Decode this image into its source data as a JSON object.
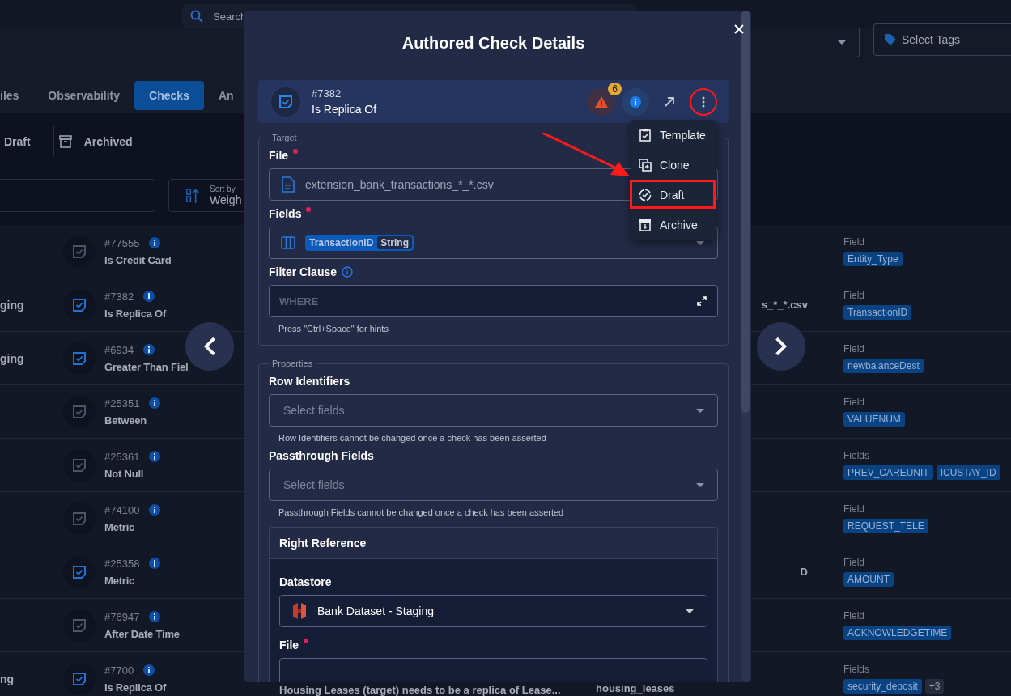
{
  "background": {
    "search": {
      "placeholder": "Search"
    },
    "tag_filter": {
      "placeholder": "Select Tags"
    },
    "tabs": [
      {
        "label": "iles",
        "selected": false
      },
      {
        "label": "Observability",
        "selected": false
      },
      {
        "label": "Checks",
        "selected": true
      },
      {
        "label": "An",
        "selected": false
      }
    ],
    "status_filters": [
      {
        "label": "Draft",
        "kind": "draft"
      },
      {
        "label": "Archived",
        "kind": "archived"
      }
    ],
    "sort": {
      "label": "Sort by",
      "value": "Weigh"
    },
    "rows": [
      {
        "id": "#77555",
        "name": "Is Credit Card",
        "color": "#4c5467",
        "field_label": "Field",
        "tags": [
          "Entity_Type"
        ]
      },
      {
        "edge": "ging",
        "id": "#7382",
        "name": "Is Replica Of",
        "color": "#1f73d6",
        "file_tail": "s_*_*.csv",
        "field_label": "Field",
        "tags": [
          "TransactionID"
        ]
      },
      {
        "edge": "ging",
        "id": "#6934",
        "name": "Greater Than Fiel",
        "color": "#1f73d6",
        "field_label": "Field",
        "tags": [
          "newbalanceDest"
        ]
      },
      {
        "id": "#25351",
        "name": "Between",
        "color": "#4c5467",
        "field_label": "Field",
        "tags": [
          "VALUENUM"
        ]
      },
      {
        "id": "#25361",
        "name": "Not Null",
        "color": "#4c5467",
        "field_label": "Fields",
        "tags": [
          "PREV_CAREUNIT",
          "ICUSTAY_ID"
        ]
      },
      {
        "id": "#74100",
        "name": "Metric",
        "color": "#4c5467",
        "field_label": "Field",
        "tags": [
          "REQUEST_TELE"
        ]
      },
      {
        "id": "#25358",
        "name": "Metric",
        "color": "#1f73d6",
        "file_tail": "D",
        "field_label": "Field",
        "tags": [
          "AMOUNT"
        ]
      },
      {
        "id": "#76947",
        "name": "After Date Time",
        "color": "#4c5467",
        "field_label": "Field",
        "tags": [
          "ACKNOWLEDGETIME"
        ]
      },
      {
        "edge": "ng",
        "id": "#7700",
        "name": "Is Replica Of",
        "color": "#1f73d6",
        "description": "Housing Leases (target) needs to be a replica of Lease...",
        "file": "housing_leases",
        "field_label": "Fields",
        "tags": [
          "security_deposit"
        ],
        "more": "+3"
      }
    ]
  },
  "modal": {
    "title": "Authored Check Details",
    "check": {
      "id": "#7382",
      "name": "Is Replica Of",
      "alerts": "6"
    },
    "menu": [
      {
        "label": "Template",
        "kind": "template"
      },
      {
        "label": "Clone",
        "kind": "clone"
      },
      {
        "label": "Draft",
        "kind": "draft"
      },
      {
        "label": "Archive",
        "kind": "archive"
      }
    ],
    "target": {
      "legend": "Target",
      "file": {
        "label": "File",
        "required": true,
        "value": "extension_bank_transactions_*_*.csv"
      },
      "fields": {
        "label": "Fields",
        "required": true,
        "chip": {
          "name": "TransactionID",
          "type": "String"
        }
      },
      "filter": {
        "label": "Filter Clause",
        "placeholder": "WHERE",
        "hint": "Press \"Ctrl+Space\" for hints"
      }
    },
    "properties": {
      "legend": "Properties",
      "selects": [
        {
          "label": "Row Identifiers",
          "placeholder": "Select fields",
          "hint": "Row Identifiers cannot be changed once a check has been asserted"
        },
        {
          "label": "Passthrough Fields",
          "placeholder": "Select fields",
          "hint": "Passthrough Fields cannot be changed once a check has been asserted"
        }
      ],
      "right_reference": {
        "title": "Right Reference",
        "datastore": {
          "label": "Datastore",
          "value": "Bank Dataset - Staging"
        },
        "file": {
          "label": "File",
          "required": true
        }
      }
    }
  }
}
